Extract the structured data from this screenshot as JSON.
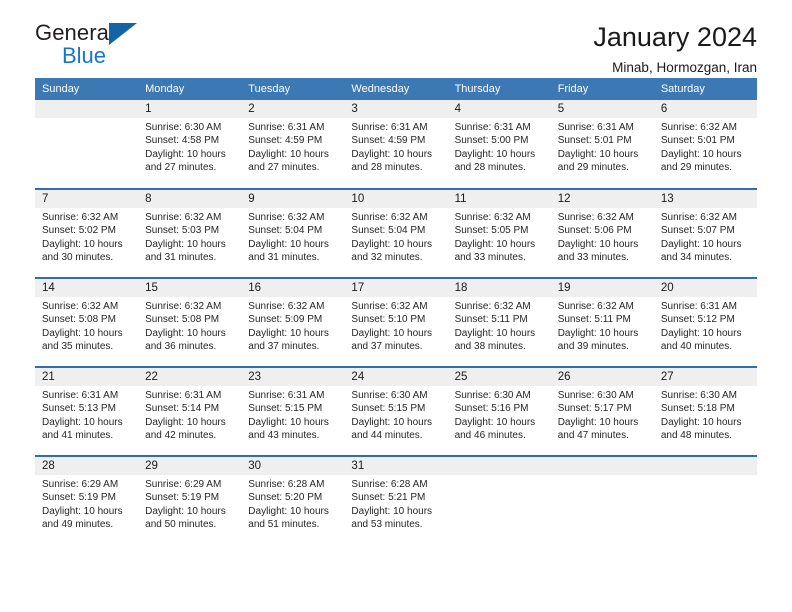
{
  "brand": {
    "name_part1": "General",
    "name_part2": "Blue",
    "flag_icon": "triangle-flag-icon"
  },
  "header": {
    "title": "January 2024",
    "subtitle": "Minab, Hormozgan, Iran"
  },
  "theme": {
    "header_blue": "#3c78b4",
    "rule_blue": "#2f6fad",
    "band_gray": "#efefef",
    "brand_blue": "#1877c4"
  },
  "weekdays": [
    "Sunday",
    "Monday",
    "Tuesday",
    "Wednesday",
    "Thursday",
    "Friday",
    "Saturday"
  ],
  "weeks": [
    [
      {
        "day": "",
        "sunrise": "",
        "sunset": "",
        "daylight1": "",
        "daylight2": ""
      },
      {
        "day": "1",
        "sunrise": "Sunrise: 6:30 AM",
        "sunset": "Sunset: 4:58 PM",
        "daylight1": "Daylight: 10 hours",
        "daylight2": "and 27 minutes."
      },
      {
        "day": "2",
        "sunrise": "Sunrise: 6:31 AM",
        "sunset": "Sunset: 4:59 PM",
        "daylight1": "Daylight: 10 hours",
        "daylight2": "and 27 minutes."
      },
      {
        "day": "3",
        "sunrise": "Sunrise: 6:31 AM",
        "sunset": "Sunset: 4:59 PM",
        "daylight1": "Daylight: 10 hours",
        "daylight2": "and 28 minutes."
      },
      {
        "day": "4",
        "sunrise": "Sunrise: 6:31 AM",
        "sunset": "Sunset: 5:00 PM",
        "daylight1": "Daylight: 10 hours",
        "daylight2": "and 28 minutes."
      },
      {
        "day": "5",
        "sunrise": "Sunrise: 6:31 AM",
        "sunset": "Sunset: 5:01 PM",
        "daylight1": "Daylight: 10 hours",
        "daylight2": "and 29 minutes."
      },
      {
        "day": "6",
        "sunrise": "Sunrise: 6:32 AM",
        "sunset": "Sunset: 5:01 PM",
        "daylight1": "Daylight: 10 hours",
        "daylight2": "and 29 minutes."
      }
    ],
    [
      {
        "day": "7",
        "sunrise": "Sunrise: 6:32 AM",
        "sunset": "Sunset: 5:02 PM",
        "daylight1": "Daylight: 10 hours",
        "daylight2": "and 30 minutes."
      },
      {
        "day": "8",
        "sunrise": "Sunrise: 6:32 AM",
        "sunset": "Sunset: 5:03 PM",
        "daylight1": "Daylight: 10 hours",
        "daylight2": "and 31 minutes."
      },
      {
        "day": "9",
        "sunrise": "Sunrise: 6:32 AM",
        "sunset": "Sunset: 5:04 PM",
        "daylight1": "Daylight: 10 hours",
        "daylight2": "and 31 minutes."
      },
      {
        "day": "10",
        "sunrise": "Sunrise: 6:32 AM",
        "sunset": "Sunset: 5:04 PM",
        "daylight1": "Daylight: 10 hours",
        "daylight2": "and 32 minutes."
      },
      {
        "day": "11",
        "sunrise": "Sunrise: 6:32 AM",
        "sunset": "Sunset: 5:05 PM",
        "daylight1": "Daylight: 10 hours",
        "daylight2": "and 33 minutes."
      },
      {
        "day": "12",
        "sunrise": "Sunrise: 6:32 AM",
        "sunset": "Sunset: 5:06 PM",
        "daylight1": "Daylight: 10 hours",
        "daylight2": "and 33 minutes."
      },
      {
        "day": "13",
        "sunrise": "Sunrise: 6:32 AM",
        "sunset": "Sunset: 5:07 PM",
        "daylight1": "Daylight: 10 hours",
        "daylight2": "and 34 minutes."
      }
    ],
    [
      {
        "day": "14",
        "sunrise": "Sunrise: 6:32 AM",
        "sunset": "Sunset: 5:08 PM",
        "daylight1": "Daylight: 10 hours",
        "daylight2": "and 35 minutes."
      },
      {
        "day": "15",
        "sunrise": "Sunrise: 6:32 AM",
        "sunset": "Sunset: 5:08 PM",
        "daylight1": "Daylight: 10 hours",
        "daylight2": "and 36 minutes."
      },
      {
        "day": "16",
        "sunrise": "Sunrise: 6:32 AM",
        "sunset": "Sunset: 5:09 PM",
        "daylight1": "Daylight: 10 hours",
        "daylight2": "and 37 minutes."
      },
      {
        "day": "17",
        "sunrise": "Sunrise: 6:32 AM",
        "sunset": "Sunset: 5:10 PM",
        "daylight1": "Daylight: 10 hours",
        "daylight2": "and 37 minutes."
      },
      {
        "day": "18",
        "sunrise": "Sunrise: 6:32 AM",
        "sunset": "Sunset: 5:11 PM",
        "daylight1": "Daylight: 10 hours",
        "daylight2": "and 38 minutes."
      },
      {
        "day": "19",
        "sunrise": "Sunrise: 6:32 AM",
        "sunset": "Sunset: 5:11 PM",
        "daylight1": "Daylight: 10 hours",
        "daylight2": "and 39 minutes."
      },
      {
        "day": "20",
        "sunrise": "Sunrise: 6:31 AM",
        "sunset": "Sunset: 5:12 PM",
        "daylight1": "Daylight: 10 hours",
        "daylight2": "and 40 minutes."
      }
    ],
    [
      {
        "day": "21",
        "sunrise": "Sunrise: 6:31 AM",
        "sunset": "Sunset: 5:13 PM",
        "daylight1": "Daylight: 10 hours",
        "daylight2": "and 41 minutes."
      },
      {
        "day": "22",
        "sunrise": "Sunrise: 6:31 AM",
        "sunset": "Sunset: 5:14 PM",
        "daylight1": "Daylight: 10 hours",
        "daylight2": "and 42 minutes."
      },
      {
        "day": "23",
        "sunrise": "Sunrise: 6:31 AM",
        "sunset": "Sunset: 5:15 PM",
        "daylight1": "Daylight: 10 hours",
        "daylight2": "and 43 minutes."
      },
      {
        "day": "24",
        "sunrise": "Sunrise: 6:30 AM",
        "sunset": "Sunset: 5:15 PM",
        "daylight1": "Daylight: 10 hours",
        "daylight2": "and 44 minutes."
      },
      {
        "day": "25",
        "sunrise": "Sunrise: 6:30 AM",
        "sunset": "Sunset: 5:16 PM",
        "daylight1": "Daylight: 10 hours",
        "daylight2": "and 46 minutes."
      },
      {
        "day": "26",
        "sunrise": "Sunrise: 6:30 AM",
        "sunset": "Sunset: 5:17 PM",
        "daylight1": "Daylight: 10 hours",
        "daylight2": "and 47 minutes."
      },
      {
        "day": "27",
        "sunrise": "Sunrise: 6:30 AM",
        "sunset": "Sunset: 5:18 PM",
        "daylight1": "Daylight: 10 hours",
        "daylight2": "and 48 minutes."
      }
    ],
    [
      {
        "day": "28",
        "sunrise": "Sunrise: 6:29 AM",
        "sunset": "Sunset: 5:19 PM",
        "daylight1": "Daylight: 10 hours",
        "daylight2": "and 49 minutes."
      },
      {
        "day": "29",
        "sunrise": "Sunrise: 6:29 AM",
        "sunset": "Sunset: 5:19 PM",
        "daylight1": "Daylight: 10 hours",
        "daylight2": "and 50 minutes."
      },
      {
        "day": "30",
        "sunrise": "Sunrise: 6:28 AM",
        "sunset": "Sunset: 5:20 PM",
        "daylight1": "Daylight: 10 hours",
        "daylight2": "and 51 minutes."
      },
      {
        "day": "31",
        "sunrise": "Sunrise: 6:28 AM",
        "sunset": "Sunset: 5:21 PM",
        "daylight1": "Daylight: 10 hours",
        "daylight2": "and 53 minutes."
      },
      {
        "day": "",
        "sunrise": "",
        "sunset": "",
        "daylight1": "",
        "daylight2": ""
      },
      {
        "day": "",
        "sunrise": "",
        "sunset": "",
        "daylight1": "",
        "daylight2": ""
      },
      {
        "day": "",
        "sunrise": "",
        "sunset": "",
        "daylight1": "",
        "daylight2": ""
      }
    ]
  ]
}
